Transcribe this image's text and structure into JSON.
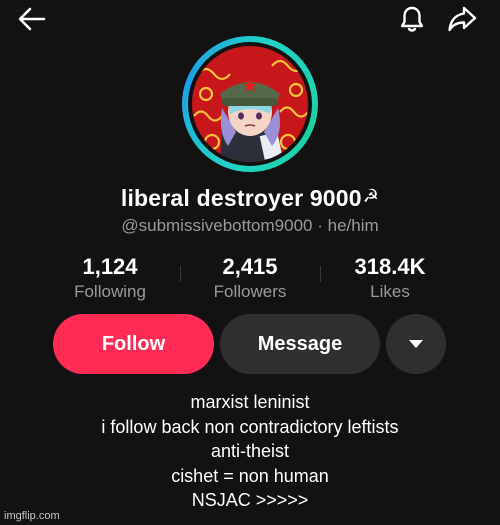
{
  "icons": {
    "back": "back-arrow-icon",
    "notifications": "bell-icon",
    "share": "share-icon",
    "more": "caret-down-icon"
  },
  "profile": {
    "display_name": "liberal destroyer 9000",
    "name_symbol": "☭",
    "handle": "@submissivebottom9000",
    "separator": " · ",
    "pronouns": "he/him"
  },
  "stats": [
    {
      "value": "1,124",
      "label": "Following"
    },
    {
      "value": "2,415",
      "label": "Followers"
    },
    {
      "value": "318.4K",
      "label": "Likes"
    }
  ],
  "actions": {
    "follow": "Follow",
    "message": "Message"
  },
  "bio": [
    "marxist leninist",
    "i follow back non contradictory leftists",
    "anti-theist",
    "cishet = non human",
    "NSJAC >>>>>"
  ],
  "watermark": "imgflip.com",
  "colors": {
    "background": "#121212",
    "follow_button": "#fe2c55",
    "secondary_button": "#2f2f2f",
    "muted_text": "#9a9a9a"
  }
}
